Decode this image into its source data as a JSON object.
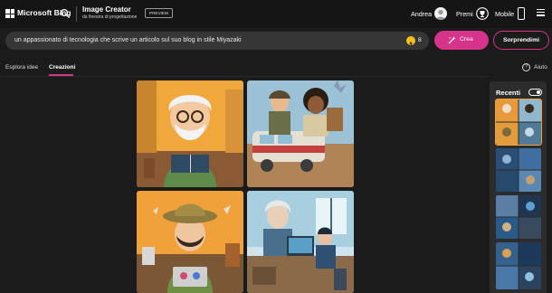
{
  "header": {
    "brand": "Microsoft Bing",
    "title": "Image Creator",
    "subtitle": "da finestra di progettazione",
    "preview_badge": "PREVIEW",
    "user_name": "Andrea",
    "rewards_label": "Premi",
    "mobile_label": "Mobile"
  },
  "prompt": {
    "value": "un appassionato di tecnologia che scrive un articolo sul suo blog in stile Miyazaki",
    "boosts": "8"
  },
  "buttons": {
    "create": "Crea",
    "surprise": "Sorprendimi"
  },
  "tabs": [
    {
      "label": "Esplora idee",
      "active": false
    },
    {
      "label": "Creazioni",
      "active": true
    }
  ],
  "help_label": "Aiuto",
  "recent": {
    "title": "Recenti"
  },
  "colors": {
    "accent": "#d6338a",
    "background": "#1b1b1b",
    "panel": "#2c2c2c",
    "boost": "#f3c316"
  }
}
